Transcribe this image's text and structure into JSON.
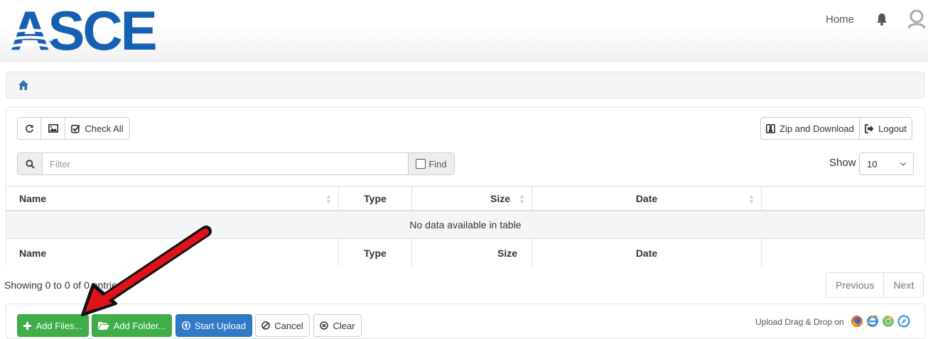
{
  "header": {
    "logo_text": "ASCE",
    "nav_home": "Home",
    "colors": {
      "logo_blue": "#1560b2"
    }
  },
  "toolbar": {
    "refresh_icon": "refresh-icon",
    "image_icon": "image-icon",
    "check_all_label": "Check All",
    "zip_download_label": "Zip and Download",
    "logout_label": "Logout"
  },
  "filter": {
    "placeholder": "Filter",
    "find_label": "Find",
    "show_label": "Show",
    "show_value": "10"
  },
  "table": {
    "columns": [
      "Name",
      "Type",
      "Size",
      "Date",
      ""
    ],
    "empty_message": "No data available in table",
    "footer_columns": [
      "Name",
      "Type",
      "Size",
      "Date",
      ""
    ]
  },
  "pagination": {
    "info": "Showing 0 to 0 of 0 entries",
    "previous": "Previous",
    "next": "Next"
  },
  "upload": {
    "add_files": "Add Files...",
    "add_folder": "Add Folder...",
    "start_upload": "Start Upload",
    "cancel": "Cancel",
    "clear": "Clear",
    "drag_drop": "Upload Drag & Drop on",
    "browsers": [
      "firefox-icon",
      "ie-icon",
      "chrome-icon",
      "safari-icon"
    ],
    "colors": {
      "green": "#3fae49",
      "blue": "#3079c7"
    }
  },
  "annotation": {
    "arrow_color": "#e0121a"
  }
}
